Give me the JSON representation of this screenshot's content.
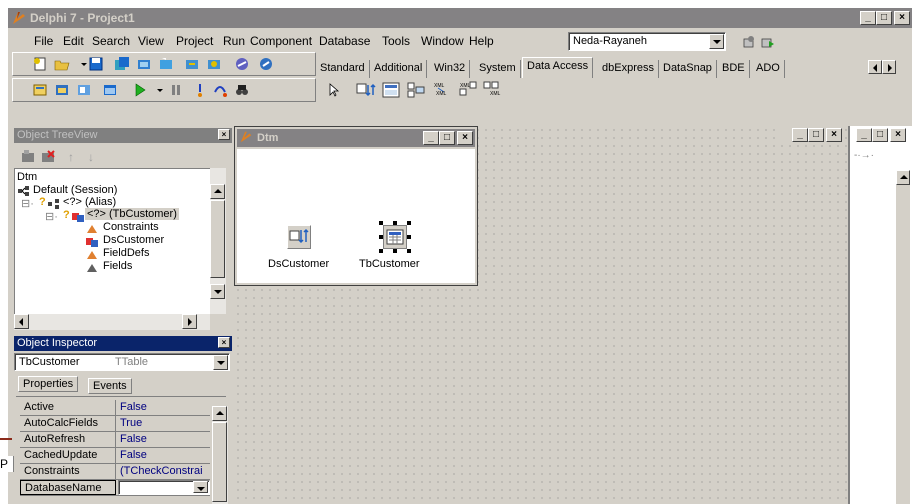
{
  "app": {
    "title": "Delphi 7 - Project1"
  },
  "menu": [
    "File",
    "Edit",
    "Search",
    "View",
    "Project",
    "Run",
    "Component",
    "Database",
    "Tools",
    "Window",
    "Help"
  ],
  "desktop_combo": {
    "value": "Neda-Rayaneh"
  },
  "palette": {
    "tabs": [
      "Standard",
      "Additional",
      "Win32",
      "System",
      "Data Access",
      "dbExpress",
      "DataSnap",
      "BDE",
      "ADO"
    ],
    "active_tab": "Data Access"
  },
  "tree_view": {
    "title": "Object TreeView",
    "nodes": [
      "Dtm",
      "Default (Session)",
      "<?> (Alias)",
      "<?> (TbCustomer)",
      "Constraints",
      "DsCustomer",
      "FieldDefs",
      "Fields"
    ]
  },
  "inspector": {
    "title": "Object Inspector",
    "object_name": "TbCustomer",
    "object_type": "TTable",
    "tabs": [
      "Properties",
      "Events"
    ],
    "rows": [
      {
        "name": "Active",
        "value": "False"
      },
      {
        "name": "AutoCalcFields",
        "value": "True"
      },
      {
        "name": "AutoRefresh",
        "value": "False"
      },
      {
        "name": "CachedUpdate",
        "value": "False"
      },
      {
        "name": "Constraints",
        "value": "(TCheckConstrai"
      },
      {
        "name": "DatabaseName",
        "value": ""
      }
    ]
  },
  "datamodule": {
    "title": "Dtm",
    "components": [
      {
        "label": "DsCustomer"
      },
      {
        "label": "TbCustomer"
      }
    ]
  },
  "edge_text": "P"
}
